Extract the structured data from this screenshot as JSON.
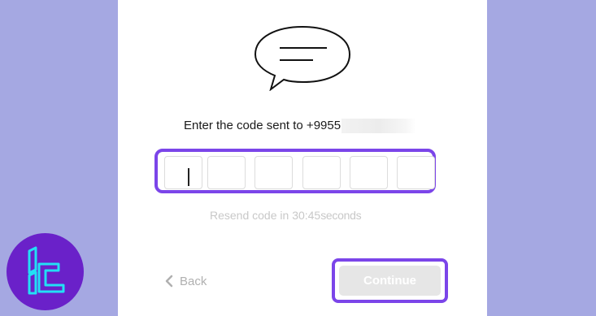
{
  "verification": {
    "prompt_text": "Enter the code sent to +9955",
    "code_digits": [
      "",
      "",
      "",
      "",
      "",
      ""
    ],
    "resend_prefix": "Resend code in",
    "timer": "30:45",
    "resend_suffix": "seconds"
  },
  "actions": {
    "back_label": "Back",
    "continue_label": "Continue"
  },
  "colors": {
    "background": "#a5a8e2",
    "accent": "#7b45e9",
    "logo_bg": "#6a21c9",
    "logo_stroke": "#22e0f5"
  },
  "icons": [
    "chat-bubble-icon",
    "chevron-left-icon",
    "brand-logo-icon"
  ]
}
